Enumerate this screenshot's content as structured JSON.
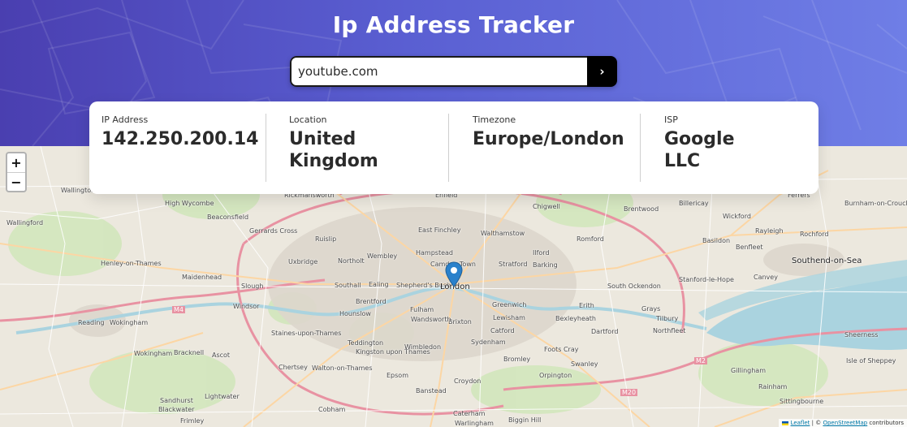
{
  "header": {
    "title": "Ip Address Tracker"
  },
  "search": {
    "value": "youtube.com",
    "button_label": "›"
  },
  "info": {
    "ip": {
      "label": "IP Address",
      "value": "142.250.200.14"
    },
    "location": {
      "label": "Location",
      "value_line1": "United",
      "value_line2": "Kingdom"
    },
    "timezone": {
      "label": "Timezone",
      "value": "Europe/London"
    },
    "isp": {
      "label": "ISP",
      "value_line1": "Google",
      "value_line2": "LLC"
    }
  },
  "map": {
    "zoom_in": "+",
    "zoom_out": "−",
    "attribution": {
      "leaflet": "Leaflet",
      "separator": " | © ",
      "osm": "OpenStreetMap",
      "contributors": " contributors"
    },
    "labels": [
      "Wallington",
      "High Wycombe",
      "Rickmansworth",
      "Enfield",
      "Chigwell",
      "Brentwood",
      "Billericay",
      "Ferrers",
      "Burnham-on-Crouch",
      "Wallingford",
      "Beaconsfield",
      "Gerrards Cross",
      "Ruislip",
      "East Finchley",
      "Walthamstow",
      "Romford",
      "Wickford",
      "Rayleigh",
      "Rochford",
      "Henley-on-Thames",
      "Maidenhead",
      "Slough",
      "Uxbridge",
      "Northolt",
      "Wembley",
      "Hampstead",
      "Camden Town",
      "Ilford",
      "Barking",
      "Basildon",
      "Benfleet",
      "Southend-on-Sea",
      "Canvey",
      "South Ockendon",
      "Stanford-le-Hope",
      "Southall",
      "Ealing",
      "Shepherd's Bush",
      "London",
      "Stratford",
      "Windsor",
      "Hounslow",
      "Brentford",
      "Fulham",
      "Greenwich",
      "Erith",
      "Grays",
      "Tilbury",
      "Reading",
      "Wokingham",
      "Bracknell",
      "Ascot",
      "Staines-upon-Thames",
      "Teddington",
      "Kingston upon Thames",
      "Wimbledon",
      "Brixton",
      "Sydenham",
      "Catford",
      "Bexleyheath",
      "Dartford",
      "Northfleet",
      "Sheerness",
      "Isle of Sheppey",
      "Chertsey",
      "Walton-on-Thames",
      "Epsom",
      "Croydon",
      "Bromley",
      "Orpington",
      "Swanley",
      "Foots Cray",
      "Gillingham",
      "Rainham",
      "Sandhurst",
      "Blackwater",
      "Lightwater",
      "Cobham",
      "Banstead",
      "Caterham",
      "Biggin Hill",
      "Warlingham",
      "Frimley",
      "Sittingbourne",
      "Wandsworth",
      "Lewisham",
      "M4",
      "M20",
      "M2",
      "Wokingham"
    ]
  }
}
